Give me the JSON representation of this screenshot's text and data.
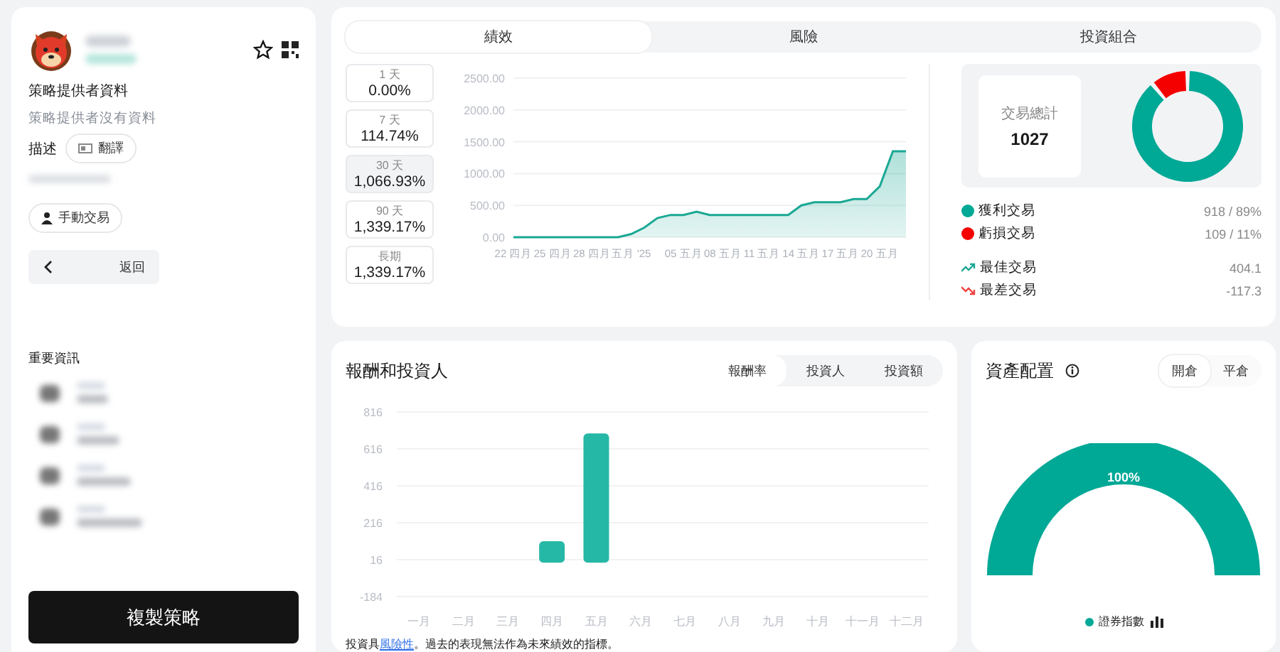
{
  "provider": {
    "section_title": "策略提供者資料",
    "no_data": "策略提供者沒有資料",
    "description_label": "描述",
    "translate": "翻譯",
    "manual_tag": "手動交易",
    "back": "返回",
    "key_info_title": "重要資訊",
    "copy_button": "複製策略"
  },
  "performance": {
    "tabs": [
      {
        "label": "績效",
        "selected": true
      },
      {
        "label": "風險",
        "selected": false
      },
      {
        "label": "投資組合",
        "selected": false
      }
    ],
    "periods": [
      {
        "label": "1 天",
        "value": "0.00%",
        "selected": false
      },
      {
        "label": "7 天",
        "value": "114.74%",
        "selected": false
      },
      {
        "label": "30 天",
        "value": "1,066.93%",
        "selected": true
      },
      {
        "label": "90 天",
        "value": "1,339.17%",
        "selected": false
      },
      {
        "label": "長期",
        "value": "1,339.17%",
        "selected": false
      }
    ],
    "chart_data": {
      "type": "area",
      "grid": true,
      "categories": [
        "22 四月",
        null,
        null,
        "25 四月",
        null,
        null,
        "28 四月",
        null,
        null,
        "五月 '25",
        null,
        null,
        null,
        "05 五月",
        null,
        null,
        "08 五月",
        null,
        null,
        "11 五月",
        null,
        null,
        "14 五月",
        null,
        null,
        "17 五月",
        null,
        null,
        "20 五月",
        null,
        null
      ],
      "series": [
        {
          "color": "#1aa894",
          "values": [
            0,
            0,
            0,
            0,
            0,
            0,
            0,
            0,
            0,
            50,
            150,
            300,
            350,
            350,
            400,
            350,
            350,
            350,
            350,
            350,
            350,
            350,
            500,
            550,
            550,
            550,
            600,
            600,
            800,
            1350,
            1350
          ]
        }
      ],
      "ylim": [
        0,
        2500
      ],
      "yticks": [
        {
          "value": 0,
          "label": "0.00"
        },
        {
          "value": 500,
          "label": "500.00"
        },
        {
          "value": 1000,
          "label": "1000.00"
        },
        {
          "value": 1500,
          "label": "1500.00"
        },
        {
          "value": 2000,
          "label": "2000.00"
        },
        {
          "value": 2500,
          "label": "2500.00"
        }
      ]
    },
    "total_label": "交易總計",
    "total_value": "1027",
    "trades_chart": {
      "chart_data": {
        "type": "donut",
        "categories": [
          "獲利交易",
          "虧損交易"
        ],
        "series": [
          {
            "values": [
              89,
              11
            ]
          }
        ],
        "colors": [
          "#00a896",
          "#f50000"
        ]
      }
    },
    "legend": [
      {
        "kind": "dot",
        "value": "918 / 89%",
        "color": "#00a896"
      },
      {
        "kind": "dot",
        "value": "109 / 11%",
        "color": "#f50000"
      },
      {
        "kind": "up",
        "label": "最佳交易",
        "value": "404.1"
      },
      {
        "kind": "down",
        "label": "最差交易",
        "value": "-117.3"
      }
    ]
  },
  "returns": {
    "title": "報酬和投資人",
    "tabs": [
      {
        "label": "報酬率",
        "selected": true
      },
      {
        "label": "投資人",
        "selected": false
      },
      {
        "label": "投資額",
        "selected": false
      }
    ],
    "chart_data": {
      "type": "bar",
      "grid": true,
      "categories": [
        "一月",
        "二月",
        "三月",
        "四月",
        "五月",
        "六月",
        "七月",
        "八月",
        "九月",
        "十月",
        "十一月",
        "十二月"
      ],
      "series": [
        {
          "color": "#26b8a6",
          "values": [
            0,
            0,
            0,
            116,
            700,
            0,
            0,
            0,
            0,
            0,
            0,
            0
          ]
        }
      ],
      "ylim": [
        -184,
        816
      ],
      "yticks": [
        -184,
        16,
        216,
        416,
        616,
        816
      ]
    },
    "disclaimer": {
      "before": "投資具",
      "link": "風險性",
      "after": "。過去的表現無法作為未來績效的指標。"
    }
  },
  "allocation": {
    "title": "資產配置",
    "toggle": [
      {
        "label": "開倉",
        "selected": true
      },
      {
        "label": "平倉",
        "selected": false
      }
    ],
    "gauge_label": "100%",
    "legend": [
      {
        "label": "證券指數",
        "color": "#00a896"
      }
    ]
  }
}
